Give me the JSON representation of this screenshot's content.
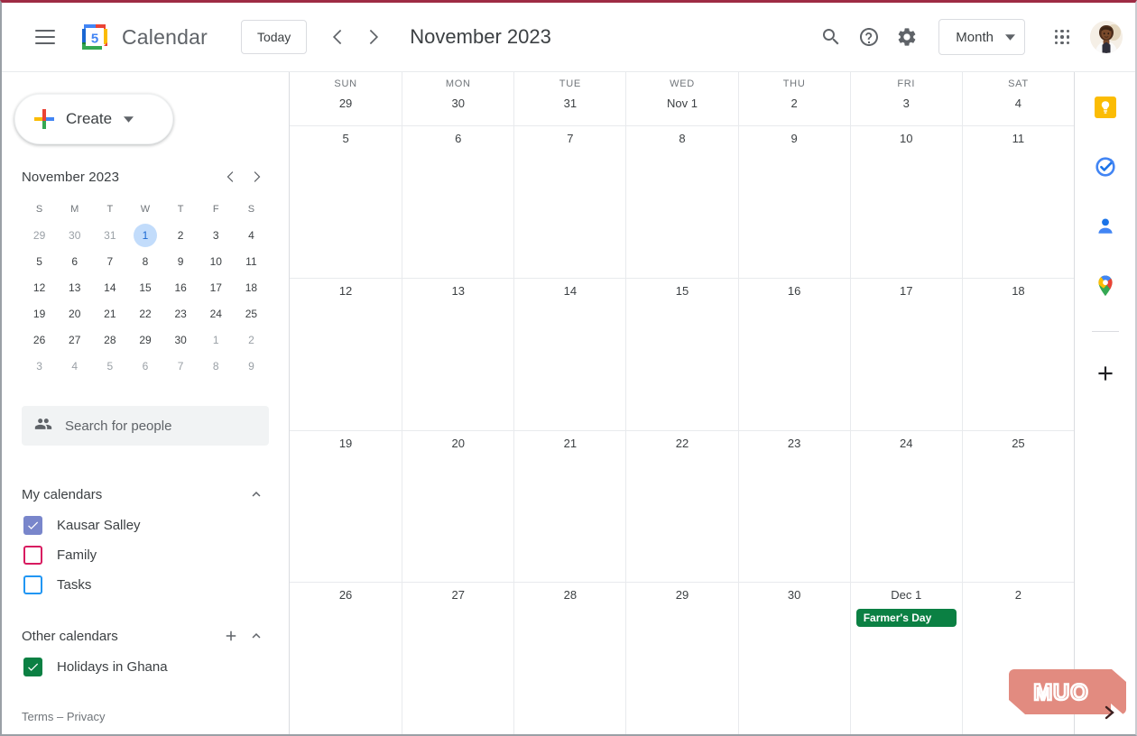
{
  "header": {
    "menu_label": "Main menu",
    "logo_day": "5",
    "app_title": "Calendar",
    "today_label": "Today",
    "prev_label": "Previous month",
    "next_label": "Next month",
    "period_title": "November 2023",
    "search_label": "Search",
    "help_label": "Support",
    "settings_label": "Settings",
    "view_label": "Month",
    "apps_label": "Google apps",
    "avatar_label": "Google Account"
  },
  "sidebar": {
    "create_label": "Create",
    "mini_calendar": {
      "title": "November 2023",
      "prev_label": "Previous month",
      "next_label": "Next month",
      "dow": [
        "S",
        "M",
        "T",
        "W",
        "T",
        "F",
        "S"
      ],
      "weeks": [
        [
          {
            "n": "29",
            "muted": true
          },
          {
            "n": "30",
            "muted": true
          },
          {
            "n": "31",
            "muted": true
          },
          {
            "n": "1",
            "muted": false,
            "today": true
          },
          {
            "n": "2",
            "muted": false
          },
          {
            "n": "3",
            "muted": false
          },
          {
            "n": "4",
            "muted": false
          }
        ],
        [
          {
            "n": "5"
          },
          {
            "n": "6"
          },
          {
            "n": "7"
          },
          {
            "n": "8"
          },
          {
            "n": "9"
          },
          {
            "n": "10"
          },
          {
            "n": "11"
          }
        ],
        [
          {
            "n": "12"
          },
          {
            "n": "13"
          },
          {
            "n": "14"
          },
          {
            "n": "15"
          },
          {
            "n": "16"
          },
          {
            "n": "17"
          },
          {
            "n": "18"
          }
        ],
        [
          {
            "n": "19"
          },
          {
            "n": "20"
          },
          {
            "n": "21"
          },
          {
            "n": "22"
          },
          {
            "n": "23"
          },
          {
            "n": "24"
          },
          {
            "n": "25"
          }
        ],
        [
          {
            "n": "26"
          },
          {
            "n": "27"
          },
          {
            "n": "28"
          },
          {
            "n": "29"
          },
          {
            "n": "30"
          },
          {
            "n": "1",
            "muted": true
          },
          {
            "n": "2",
            "muted": true
          }
        ],
        [
          {
            "n": "3",
            "muted": true
          },
          {
            "n": "4",
            "muted": true
          },
          {
            "n": "5",
            "muted": true
          },
          {
            "n": "6",
            "muted": true
          },
          {
            "n": "7",
            "muted": true
          },
          {
            "n": "8",
            "muted": true
          },
          {
            "n": "9",
            "muted": true
          }
        ]
      ]
    },
    "people_search_placeholder": "Search for people",
    "my_calendars": {
      "title": "My calendars",
      "collapse_label": "Collapse",
      "items": [
        {
          "label": "Kausar Salley",
          "color": "#7986cb",
          "checked": true
        },
        {
          "label": "Family",
          "color": "#d81b60",
          "checked": false
        },
        {
          "label": "Tasks",
          "color": "#2196f3",
          "checked": false
        }
      ]
    },
    "other_calendars": {
      "title": "Other calendars",
      "add_label": "Add other calendars",
      "collapse_label": "Collapse",
      "items": [
        {
          "label": "Holidays in Ghana",
          "color": "#0b8043",
          "checked": true
        }
      ]
    },
    "footer": {
      "terms": "Terms",
      "separator": "–",
      "privacy": "Privacy"
    }
  },
  "calendar": {
    "day_headers": [
      {
        "name": "SUN",
        "num": "29"
      },
      {
        "name": "MON",
        "num": "30"
      },
      {
        "name": "TUE",
        "num": "31"
      },
      {
        "name": "WED",
        "num": "Nov 1"
      },
      {
        "name": "THU",
        "num": "2"
      },
      {
        "name": "FRI",
        "num": "3"
      },
      {
        "name": "SAT",
        "num": "4"
      }
    ],
    "weeks": [
      [
        {
          "num": "5"
        },
        {
          "num": "6"
        },
        {
          "num": "7"
        },
        {
          "num": "8"
        },
        {
          "num": "9"
        },
        {
          "num": "10"
        },
        {
          "num": "11"
        }
      ],
      [
        {
          "num": "12"
        },
        {
          "num": "13"
        },
        {
          "num": "14"
        },
        {
          "num": "15"
        },
        {
          "num": "16"
        },
        {
          "num": "17"
        },
        {
          "num": "18"
        }
      ],
      [
        {
          "num": "19"
        },
        {
          "num": "20"
        },
        {
          "num": "21"
        },
        {
          "num": "22"
        },
        {
          "num": "23"
        },
        {
          "num": "24"
        },
        {
          "num": "25"
        }
      ],
      [
        {
          "num": "26"
        },
        {
          "num": "27"
        },
        {
          "num": "28"
        },
        {
          "num": "29"
        },
        {
          "num": "30"
        },
        {
          "num": "Dec 1",
          "event": {
            "title": "Farmer's Day",
            "color": "#0b8043"
          }
        },
        {
          "num": "2"
        }
      ]
    ]
  },
  "rail": {
    "items": [
      {
        "name": "keep-icon",
        "label": "Google Keep"
      },
      {
        "name": "tasks-icon",
        "label": "Google Tasks"
      },
      {
        "name": "contacts-icon",
        "label": "Contacts"
      },
      {
        "name": "maps-icon",
        "label": "Google Maps"
      }
    ],
    "add_label": "Get add-ons"
  },
  "watermark": {
    "text": "MUO"
  },
  "colors": {
    "accent_blue": "#1a73e8",
    "today_chip": "#c2dcfb",
    "grid_line": "#e8eaed",
    "event_green": "#0b8043",
    "watermark": "#e28b80",
    "top_border": "#9e2b44"
  }
}
